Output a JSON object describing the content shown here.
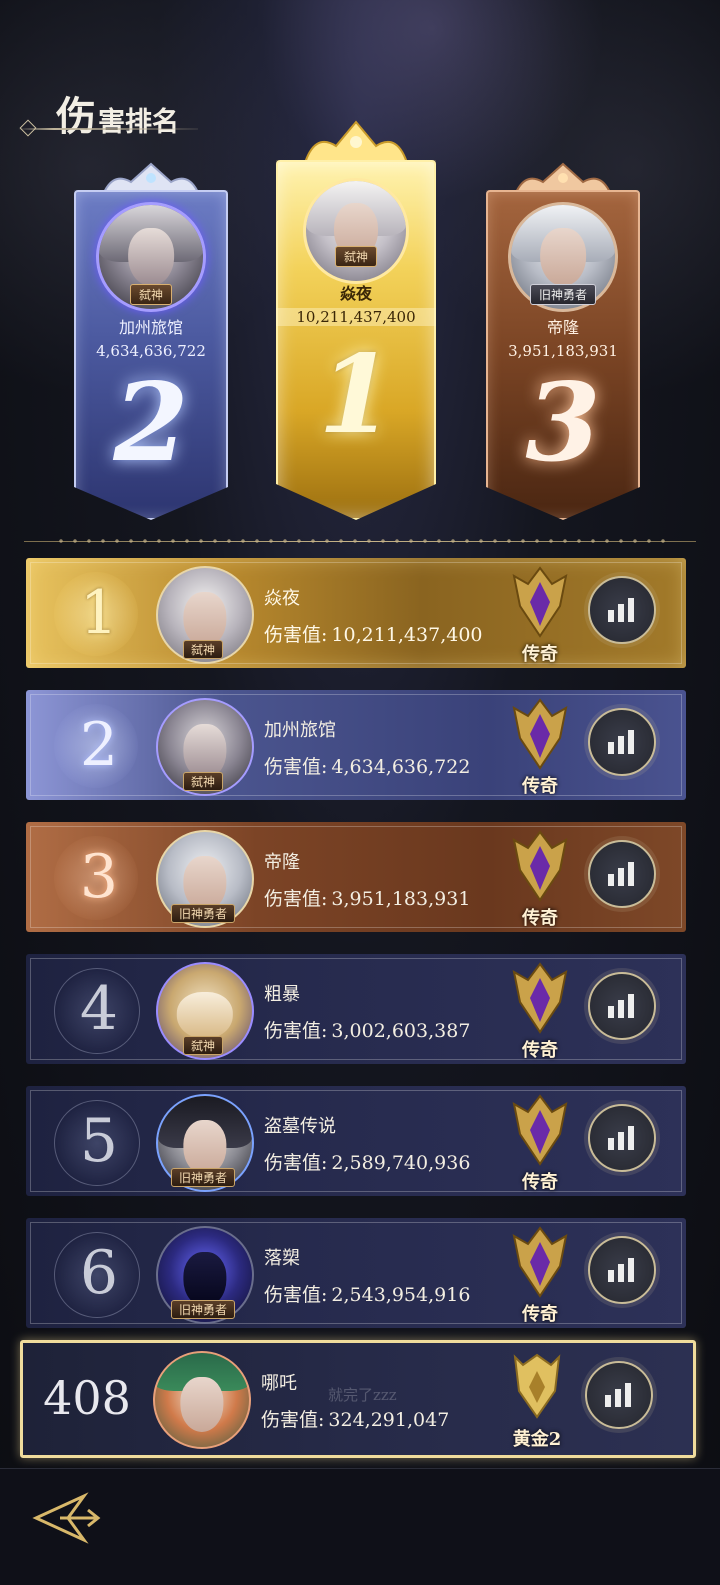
{
  "page": {
    "title_big": "伤",
    "title_small": "害排名"
  },
  "podium": [
    {
      "rank": "1",
      "name": "焱夜",
      "score": "10,211,437,400",
      "tag": "弑神"
    },
    {
      "rank": "2",
      "name": "加州旅馆",
      "score": "4,634,636,722",
      "tag": "弑神"
    },
    {
      "rank": "3",
      "name": "帝隆",
      "score": "3,951,183,931",
      "tag": "旧神勇者"
    }
  ],
  "list": [
    {
      "rank": "1",
      "name": "焱夜",
      "score_label": "伤害值:",
      "score": "10,211,437,400",
      "tag": "弑神",
      "tier": "传奇"
    },
    {
      "rank": "2",
      "name": "加州旅馆",
      "score_label": "伤害值:",
      "score": "4,634,636,722",
      "tag": "弑神",
      "tier": "传奇"
    },
    {
      "rank": "3",
      "name": "帝隆",
      "score_label": "伤害值:",
      "score": "3,951,183,931",
      "tag": "旧神勇者",
      "tier": "传奇"
    },
    {
      "rank": "4",
      "name": "粗暴",
      "score_label": "伤害值:",
      "score": "3,002,603,387",
      "tag": "弑神",
      "tier": "传奇"
    },
    {
      "rank": "5",
      "name": "盗墓传说",
      "score_label": "伤害值:",
      "score": "2,589,740,936",
      "tag": "旧神勇者",
      "tier": "传奇"
    },
    {
      "rank": "6",
      "name": "落槊",
      "score_label": "伤害值:",
      "score": "2,543,954,916",
      "tag": "旧神勇者",
      "tier": "传奇"
    }
  ],
  "self": {
    "rank": "408",
    "name": "哪吒",
    "score_label": "伤害值:",
    "score": "324,291,047",
    "tier": "黄金2"
  },
  "background_chat": "就完了zzz",
  "colors": {
    "gold": "#e8c35f",
    "silver": "#6c7cc4",
    "bronze": "#a4653e",
    "self_border": "#f0dc9c"
  },
  "icons": {
    "stats": "bar-chart-icon",
    "tier": "legend-tier-emblem",
    "back": "back-arrow-icon"
  }
}
